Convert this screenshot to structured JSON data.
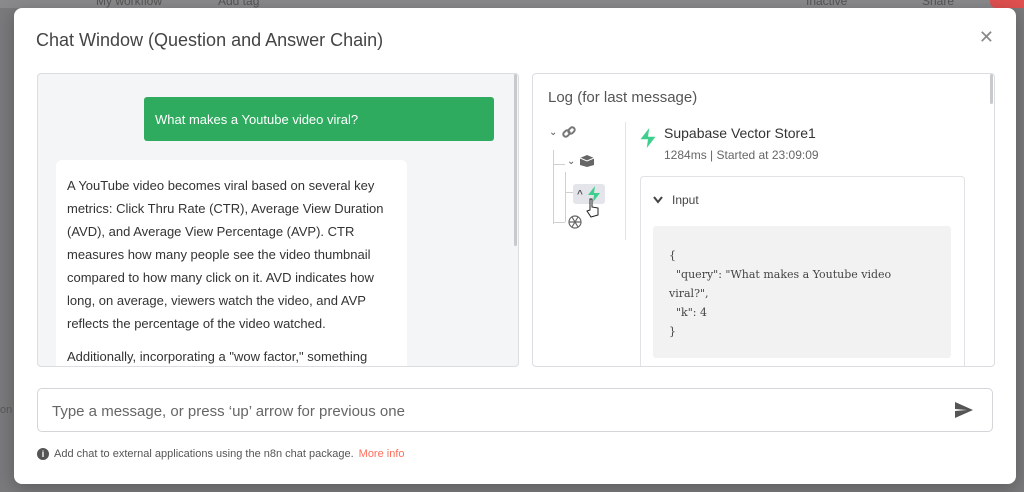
{
  "background": {
    "workflow_name": "My workflow",
    "tab": "Add tag",
    "status": "Inactive",
    "share": "Share"
  },
  "modal": {
    "title": "Chat Window (Question and Answer Chain)"
  },
  "chat": {
    "user_message": "What makes a Youtube video viral?",
    "bot_paragraphs": [
      "A YouTube video becomes viral based on several key metrics: Click Thru Rate (CTR), Average View Duration (AVD), and Average View Percentage (AVP). CTR measures how many people see the video thumbnail compared to how many click on it. AVD indicates how long, on average, viewers watch the video, and AVP reflects the percentage of the video watched.",
      "Additionally, incorporating a \"wow factor,\" something"
    ]
  },
  "log": {
    "title": "Log (for last message)",
    "node_name": "Supabase Vector Store1",
    "node_meta": "1284ms | Started at 23:09:09",
    "input_label": "Input",
    "input_json": "{\n  \"query\": \"What makes a Youtube video\nviral?\",\n  \"k\": 4\n}",
    "tree_icons": [
      "link-icon",
      "box-icon",
      "supabase-bolt-icon",
      "openai-icon"
    ]
  },
  "composer": {
    "placeholder": "Type a message, or press ‘up’ arrow for previous one"
  },
  "footer": {
    "note": "Add chat to external applications using the n8n chat package.",
    "more_info": "More info"
  },
  "colors": {
    "accent_green": "#2eab5f",
    "link_orange": "#ff6d5a"
  }
}
